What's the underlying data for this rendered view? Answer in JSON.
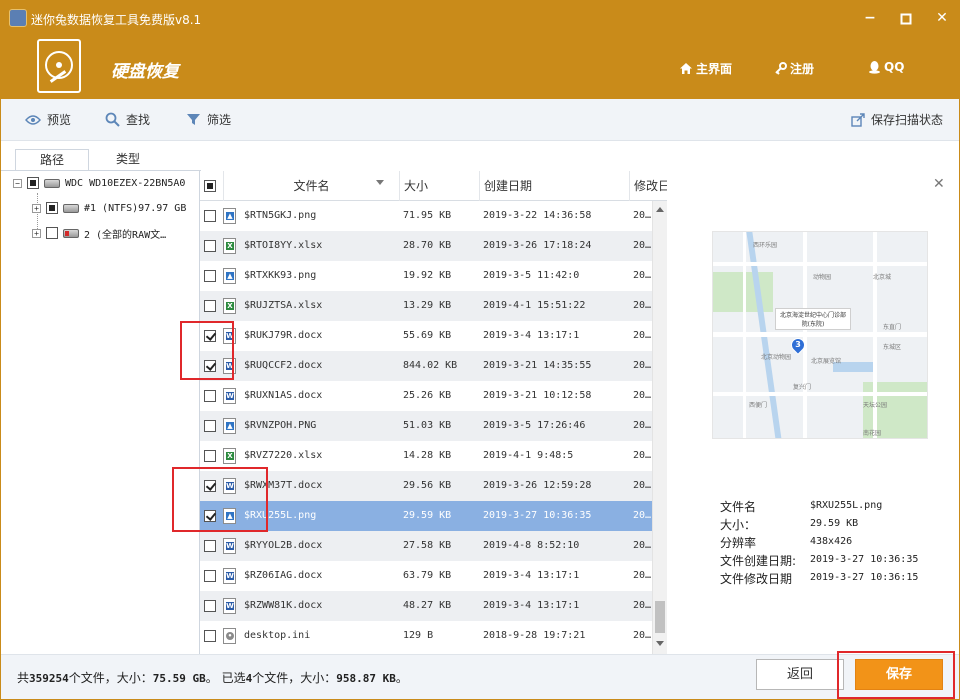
{
  "window": {
    "title": "迷你兔数据恢复工具免费版v8.1",
    "minimize_icon": "minimize-icon",
    "maximize_icon": "maximize-icon",
    "close_icon": "close-icon"
  },
  "header": {
    "module_title": "硬盘恢复",
    "nav": [
      {
        "label": "主界面",
        "icon": "home-icon"
      },
      {
        "label": "注册",
        "icon": "key-icon"
      },
      {
        "label": "QQ",
        "icon": "qq-icon"
      }
    ],
    "accent_color": "#c98b1a"
  },
  "toolbar": {
    "preview_label": "预览",
    "find_label": "查找",
    "filter_label": "筛选",
    "save_scan_label": "保存扫描状态"
  },
  "tabs": [
    "路径",
    "类型"
  ],
  "tree": [
    {
      "label": "WDC WD10EZEX-22BN5A0"
    },
    {
      "label": "#1 (NTFS)97.97 GB"
    },
    {
      "label": "2 (全部的RAW文…"
    }
  ],
  "table": {
    "headers": {
      "name": "文件名",
      "size": "大小",
      "created": "创建日期",
      "modified": "修改日"
    },
    "rows": [
      {
        "name": "$RTN5GKJ.png",
        "size": "71.95 KB",
        "created": "2019-3-22 14:36:58",
        "mod": "20…",
        "type": "image",
        "checked": false
      },
      {
        "name": "$RTOI8YY.xlsx",
        "size": "28.70 KB",
        "created": "2019-3-26 17:18:24",
        "mod": "20…",
        "type": "excel",
        "checked": false
      },
      {
        "name": "$RTXKK93.png",
        "size": "19.92 KB",
        "created": "2019-3-5 11:42:0",
        "mod": "20…",
        "type": "image",
        "checked": false
      },
      {
        "name": "$RUJZTSA.xlsx",
        "size": "13.29 KB",
        "created": "2019-4-1 15:51:22",
        "mod": "20…",
        "type": "excel",
        "checked": false
      },
      {
        "name": "$RUKJ79R.docx",
        "size": "55.69 KB",
        "created": "2019-3-4 13:17:1",
        "mod": "20…",
        "type": "word",
        "checked": true
      },
      {
        "name": "$RUQCCF2.docx",
        "size": "844.02 KB",
        "created": "2019-3-21 14:35:55",
        "mod": "20…",
        "type": "word",
        "checked": true
      },
      {
        "name": "$RUXN1AS.docx",
        "size": "25.26 KB",
        "created": "2019-3-21 10:12:58",
        "mod": "20…",
        "type": "word",
        "checked": false
      },
      {
        "name": "$RVNZPOH.PNG",
        "size": "51.03 KB",
        "created": "2019-3-5 17:26:46",
        "mod": "20…",
        "type": "image",
        "checked": false
      },
      {
        "name": "$RVZ7220.xlsx",
        "size": "14.28 KB",
        "created": "2019-4-1 9:48:5",
        "mod": "20…",
        "type": "excel",
        "checked": false
      },
      {
        "name": "$RWXM37T.docx",
        "size": "29.56 KB",
        "created": "2019-3-26 12:59:28",
        "mod": "20…",
        "type": "word",
        "checked": true
      },
      {
        "name": "$RXU255L.png",
        "size": "29.59 KB",
        "created": "2019-3-27 10:36:35",
        "mod": "20…",
        "type": "image",
        "checked": true
      },
      {
        "name": "$RYYOL2B.docx",
        "size": "27.58 KB",
        "created": "2019-4-8 8:52:10",
        "mod": "20…",
        "type": "word",
        "checked": false
      },
      {
        "name": "$RZ06IAG.docx",
        "size": "63.79 KB",
        "created": "2019-3-4 13:17:1",
        "mod": "20…",
        "type": "word",
        "checked": false
      },
      {
        "name": "$RZWW81K.docx",
        "size": "48.27 KB",
        "created": "2019-3-4 13:17:1",
        "mod": "20…",
        "type": "word",
        "checked": false
      },
      {
        "name": "desktop.ini",
        "size": "129 B",
        "created": "2018-9-28 19:7:21",
        "mod": "20…",
        "type": "sys",
        "checked": false
      }
    ]
  },
  "preview": {
    "close_icon": "close-icon",
    "map": {
      "popup_line1": "北京海淀世纪中心门诊部",
      "popup_line2": "院(东院)",
      "pin_label": "3",
      "labels": [
        "西环乐园",
        "动物园",
        "北京城",
        "北京动物园",
        "东直门",
        "北京展览馆",
        "东城区",
        "复兴门",
        "西便门",
        "天坛公园",
        "南花园"
      ]
    },
    "info": [
      {
        "key": "文件名",
        "value": "$RXU255L.png"
      },
      {
        "key": "大小：",
        "value": "29.59 KB"
      },
      {
        "key": "分辨率",
        "value": "438x426"
      },
      {
        "key": "文件创建日期:",
        "value": "2019-3-27 10:36:35"
      },
      {
        "key": "文件修改日期",
        "value": "2019-3-27 10:36:15"
      }
    ]
  },
  "footer": {
    "status_prefix": "共",
    "total_files": "359254",
    "status_mid": "个文件，大小：",
    "total_size": "75.59 GB",
    "status_mid2": "。 已选",
    "selected_count": "4",
    "status_mid3": "个文件，大小：",
    "selected_size": "958.87 KB",
    "status_end": "。",
    "back_label": "返回",
    "save_label": "保存",
    "save_color": "#f29318"
  }
}
